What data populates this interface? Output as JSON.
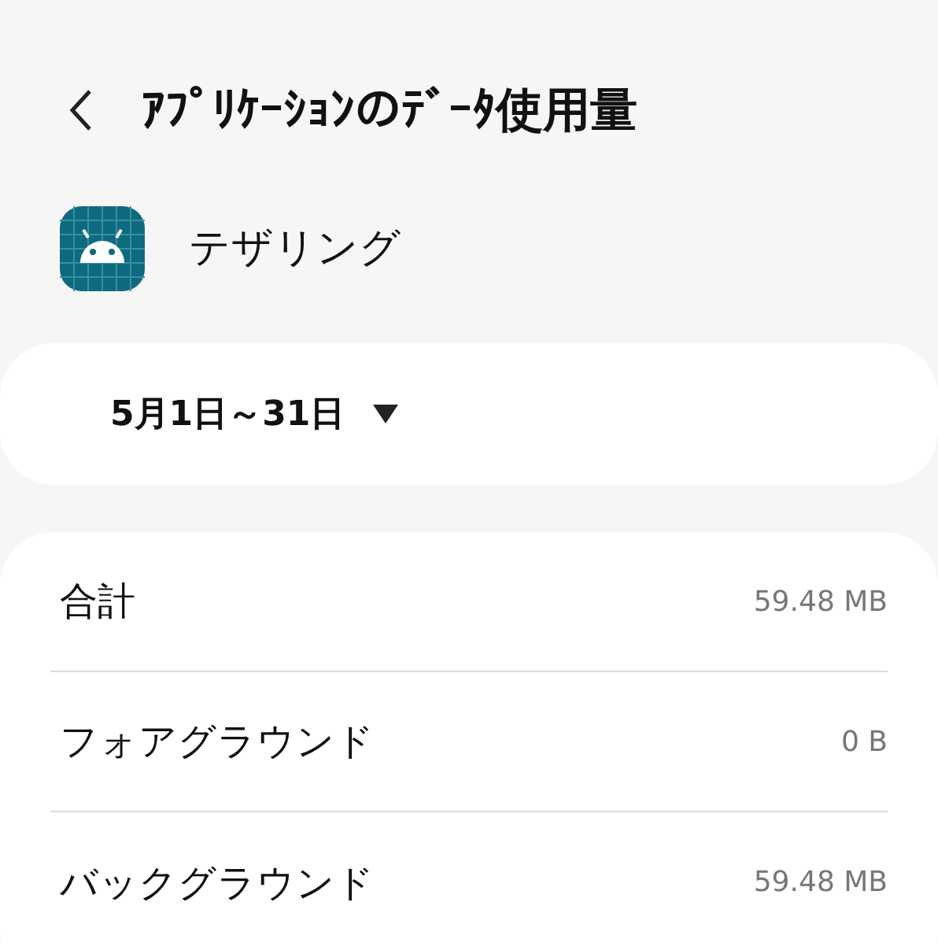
{
  "header": {
    "title": "ｱﾌﾟﾘｹｰｼｮﾝのﾃﾞｰﾀ使用量"
  },
  "app": {
    "name": "テザリング"
  },
  "period": {
    "label": "5月1日～31日",
    "expanded": false
  },
  "rows": [
    {
      "label": "合計",
      "value": "59.48 MB"
    },
    {
      "label": "フォアグラウンド",
      "value": "0 B"
    },
    {
      "label": "バックグラウンド",
      "value": "59.48 MB"
    }
  ]
}
